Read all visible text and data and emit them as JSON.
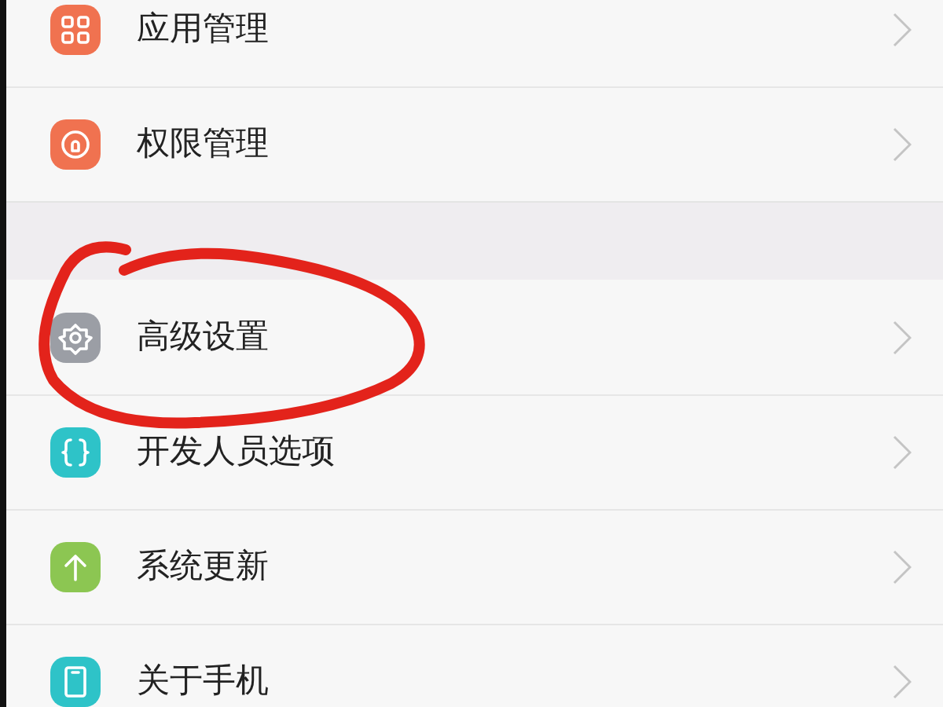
{
  "sections": [
    {
      "items": [
        {
          "label": "应用管理",
          "color": "#f07250"
        },
        {
          "label": "权限管理",
          "color": "#f07250"
        }
      ]
    },
    {
      "items": [
        {
          "label": "高级设置",
          "color": "#9b9ea5"
        },
        {
          "label": "开发人员选项",
          "color": "#2ec3c8"
        },
        {
          "label": "系统更新",
          "color": "#8cc652"
        },
        {
          "label": "关于手机",
          "color": "#2ec3c8"
        }
      ]
    }
  ]
}
